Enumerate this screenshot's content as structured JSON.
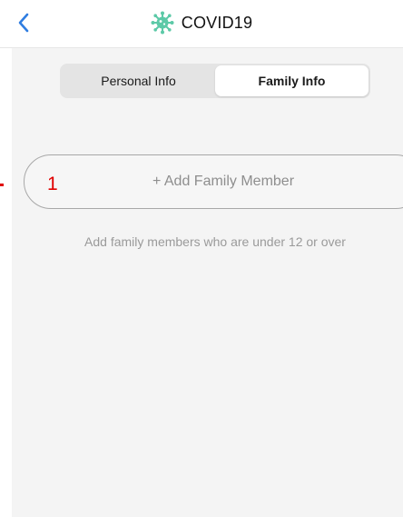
{
  "nav": {
    "title": "COVID19",
    "back_icon": "chevron-left-icon",
    "title_icon": "virus-icon",
    "accent_color": "#2f7de1",
    "icon_color": "#5cc9a7"
  },
  "tabs": [
    {
      "label": "Personal Info",
      "active": false
    },
    {
      "label": "Family Info",
      "active": true
    }
  ],
  "add_button": {
    "label": "+ Add Family Member"
  },
  "hint": "Add family members who are under 12 or over",
  "annotation": {
    "number": "1",
    "color": "#e00000"
  }
}
